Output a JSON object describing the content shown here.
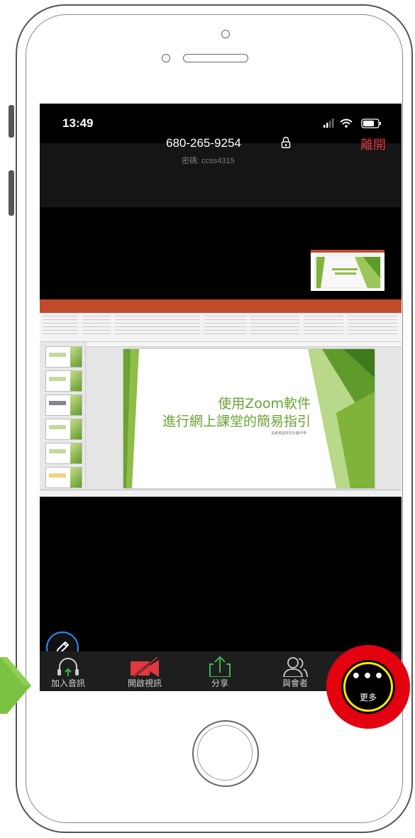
{
  "status_bar": {
    "time": "13:49"
  },
  "meeting": {
    "id": "680-265-9254",
    "passcode": "密碼: ccss4315",
    "leave_label": "離開"
  },
  "shared_slide": {
    "title_line1": "使用Zoom軟件",
    "title_line2": "進行網上課堂的簡易指引",
    "subtitle": "長者英語學習計劃中學"
  },
  "toolbar": {
    "items": [
      {
        "label": "加入音訊",
        "icon": "headphones-icon"
      },
      {
        "label": "開啟視訊",
        "icon": "video-off-icon"
      },
      {
        "label": "分享",
        "icon": "share-upload-icon"
      },
      {
        "label": "與會者",
        "icon": "participants-icon"
      },
      {
        "label": "更多",
        "icon": "more-dots-icon"
      }
    ]
  },
  "colors": {
    "leave_red": "#e0383e",
    "accent_blue": "#2d8cff",
    "share_green": "#3fb34f",
    "video_off_red": "#e0383e",
    "highlight_red": "#e3000f",
    "highlight_yellow": "#ffe600",
    "slide_green": "#6aa233"
  }
}
